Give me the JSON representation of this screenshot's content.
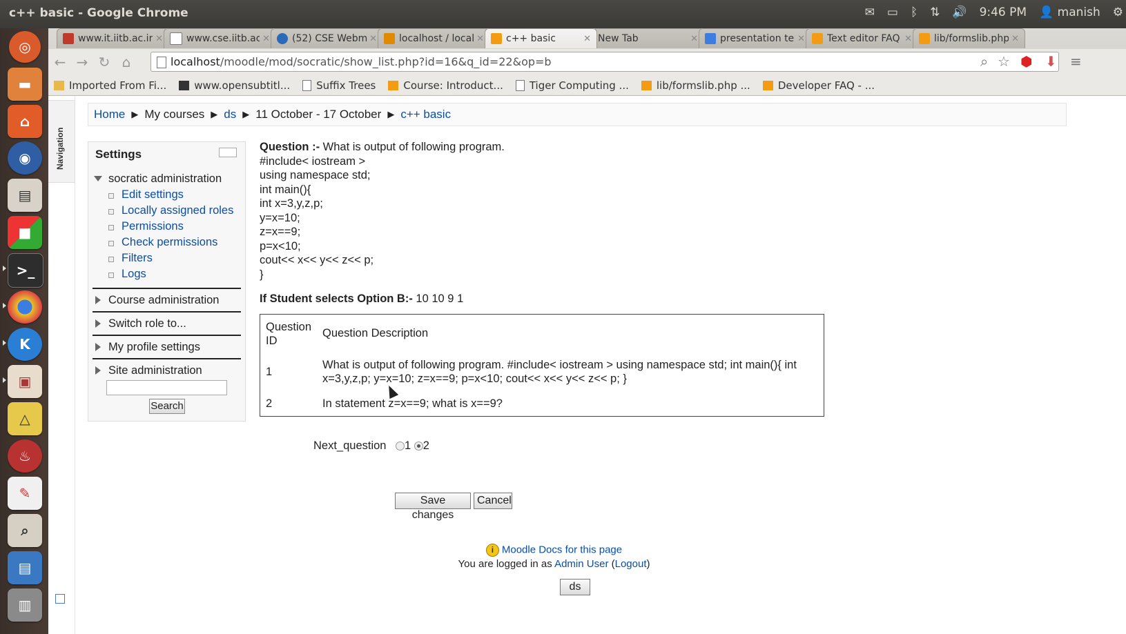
{
  "window": {
    "title": "c++ basic - Google Chrome"
  },
  "system": {
    "time": "9:46 PM",
    "user": "manish"
  },
  "tabs": [
    {
      "label": "www.it.iitb.ac.in",
      "color": "#c0392b"
    },
    {
      "label": "www.cse.iitb.ac",
      "color": "#888888"
    },
    {
      "label": "(52) CSE Webma",
      "color": "#2a6ab8"
    },
    {
      "label": "localhost / locall",
      "color": "#e08a00"
    },
    {
      "label": "c++ basic",
      "color": "#f39c12",
      "active": true
    },
    {
      "label": "New Tab",
      "color": ""
    },
    {
      "label": "presentation te",
      "color": "#3b7de0"
    },
    {
      "label": "Text editor FAQ",
      "color": "#f39c12"
    },
    {
      "label": "lib/formslib.php",
      "color": "#f39c12"
    }
  ],
  "address": {
    "host": "localhost",
    "path": "/moodle/mod/socratic/show_list.php?id=16&q_id=22&op=b"
  },
  "bookmarks": [
    "Imported From Fi...",
    "www.opensubtitl...",
    "Suffix Trees",
    "Course: Introduct...",
    "Tiger Computing ...",
    "lib/formslib.php ...",
    "Developer FAQ - ..."
  ],
  "nav_label": "Navigation",
  "breadcrumb": {
    "home": "Home",
    "mycourses": "My courses",
    "ds": "ds",
    "week": "11 October - 17 October",
    "current": "c++ basic"
  },
  "settings": {
    "title": "Settings",
    "socratic_admin": "socratic administration",
    "items": [
      "Edit settings",
      "Locally assigned roles",
      "Permissions",
      "Check permissions",
      "Filters",
      "Logs"
    ],
    "sections": [
      "Course administration",
      "Switch role to...",
      "My profile settings",
      "Site administration"
    ],
    "search_button": "Search"
  },
  "question": {
    "label": "Question :-",
    "text": " What is output of following program.",
    "code": [
      "#include< iostream >",
      "using namespace std;",
      "int main(){",
      "int x=3,y,z,p;",
      "y=x=10;",
      "z=x==9;",
      "p=x<10;",
      "cout<< x<< y<< z<< p;",
      "}"
    ],
    "option_label": "If Student selects Option B:-",
    "option_value": " 10 10 9 1"
  },
  "table": {
    "headers": [
      "Question ID",
      "Question Description"
    ],
    "rows": [
      {
        "id": "1",
        "desc1": "What is output of following program. #include< iostream > using namespace std; int main(){ int",
        "desc2": "x=3,y,z,p; y=x=10; z=x==9; p=x<10; cout<< x<< y<< z<< p; }"
      },
      {
        "id": "2",
        "desc1": "In statement z=x==9; what is x==9?",
        "desc2": ""
      }
    ]
  },
  "next_question": {
    "label": "Next_question",
    "options": [
      "1",
      "2"
    ],
    "selected": "2"
  },
  "buttons": {
    "save": "Save changes",
    "cancel": "Cancel"
  },
  "footer": {
    "docs_link": "Moodle Docs for this page",
    "logged_in_prefix": "You are logged in as ",
    "user": "Admin User",
    "logout": "Logout",
    "course_button": "ds"
  }
}
